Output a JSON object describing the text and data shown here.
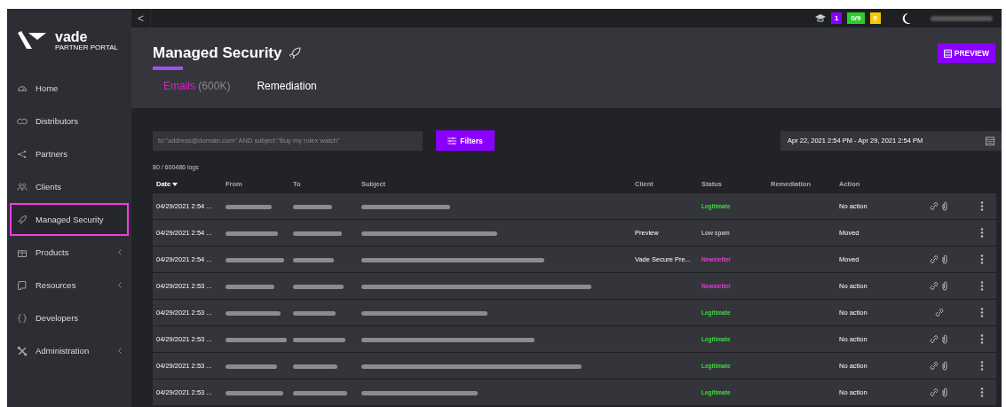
{
  "brand": {
    "name": "vade",
    "subtitle": "PARTNER PORTAL"
  },
  "sidebar": {
    "items": [
      {
        "label": "Home",
        "selected": false,
        "has_submenu": false
      },
      {
        "label": "Distributors",
        "selected": false,
        "has_submenu": false
      },
      {
        "label": "Partners",
        "selected": false,
        "has_submenu": false
      },
      {
        "label": "Clients",
        "selected": false,
        "has_submenu": false
      },
      {
        "label": "Managed Security",
        "selected": true,
        "has_submenu": false
      },
      {
        "label": "Products",
        "selected": false,
        "has_submenu": true
      },
      {
        "label": "Resources",
        "selected": false,
        "has_submenu": true
      },
      {
        "label": "Developers",
        "selected": false,
        "has_submenu": false
      },
      {
        "label": "Administration",
        "selected": false,
        "has_submenu": true
      }
    ]
  },
  "top_bar": {
    "collapse": "<",
    "badges": [
      {
        "text": "1",
        "color": "#8a00ff"
      },
      {
        "text": "0/9",
        "color": "#2ecc2e"
      },
      {
        "text": "0",
        "color": "#f5c800"
      }
    ]
  },
  "page": {
    "title": "Managed Security",
    "preview_button": "PREVIEW",
    "tabs": [
      {
        "label": "Emails",
        "count": "(600K)",
        "selected": true
      },
      {
        "label": "Remediation",
        "selected": false
      }
    ]
  },
  "search": {
    "placeholder": "to:\"address@domain.com\" AND subject:\"Buy my rolex watch\""
  },
  "filters_button": "Filters",
  "date_range": "Apr 22, 2021 2:54 PM - Apr 29, 2021 2:54 PM",
  "log_count": "80 / 600486 logs",
  "table": {
    "columns": [
      "Date",
      "From",
      "To",
      "Subject",
      "Client",
      "Status",
      "Remediation",
      "Action"
    ],
    "rows": [
      {
        "date": "04/29/2021 2:54 ...",
        "status": {
          "text": "Legitimate",
          "color": "#3ddc3d"
        },
        "action": "No action",
        "link": true,
        "attachment": true
      },
      {
        "date": "04/29/2021 2:54 ...",
        "client": "Preview",
        "status": {
          "text": "Low spam",
          "color": "#b8b8b8"
        },
        "action": "Moved",
        "link": false,
        "attachment": false
      },
      {
        "date": "04/29/2021 2:54 ...",
        "client": "Vade Secure Pre...",
        "status": {
          "text": "Newsletter",
          "color": "#e23fd0"
        },
        "action": "Moved",
        "link": true,
        "attachment": true
      },
      {
        "date": "04/29/2021 2:53 ...",
        "status": {
          "text": "Newsletter",
          "color": "#e23fd0"
        },
        "action": "No action",
        "link": true,
        "attachment": true
      },
      {
        "date": "04/29/2021 2:53 ...",
        "status": {
          "text": "Legitimate",
          "color": "#3ddc3d"
        },
        "action": "No action",
        "link": true,
        "attachment": false
      },
      {
        "date": "04/29/2021 2:53 ...",
        "status": {
          "text": "Legitimate",
          "color": "#3ddc3d"
        },
        "action": "No action",
        "link": true,
        "attachment": true
      },
      {
        "date": "04/29/2021 2:53 ...",
        "status": {
          "text": "Legitimate",
          "color": "#3ddc3d"
        },
        "action": "No action",
        "link": true,
        "attachment": true
      },
      {
        "date": "04/29/2021 2:53 ...",
        "status": {
          "text": "Legitimate",
          "color": "#3ddc3d"
        },
        "action": "No action",
        "link": true,
        "attachment": true
      }
    ]
  }
}
